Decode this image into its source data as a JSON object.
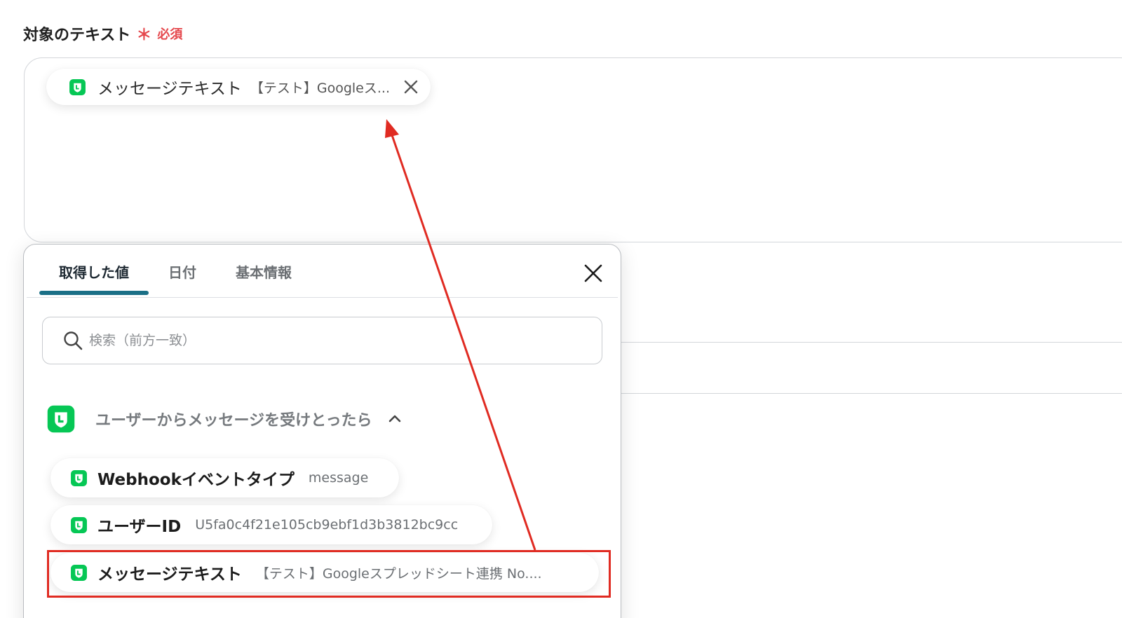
{
  "field": {
    "label": "対象のテキスト",
    "required_star": "＊",
    "required_text": "必須"
  },
  "input_chip": {
    "icon": "line-app-icon",
    "name": "メッセージテキスト",
    "value": "【テスト】Googleス...",
    "close_icon": "close-icon"
  },
  "panel": {
    "tabs": [
      {
        "label": "取得した値",
        "active": true
      },
      {
        "label": "日付",
        "active": false
      },
      {
        "label": "基本情報",
        "active": false
      }
    ],
    "close_icon": "close-icon",
    "search": {
      "icon": "search-icon",
      "placeholder": "検索（前方一致）",
      "value": ""
    },
    "group": {
      "icon": "line-app-icon",
      "title": "ユーザーからメッセージを受けとったら",
      "expanded_icon": "chevron-up-icon"
    },
    "items": [
      {
        "name": "Webhookイベントタイプ",
        "value": "message"
      },
      {
        "name": "ユーザーID",
        "value": "U5fa0c4f21e105cb9ebf1d3b3812bc9cc"
      },
      {
        "name": "メッセージテキスト",
        "value": "【テスト】Googleスプレッドシート連携 No...."
      }
    ]
  },
  "colors": {
    "accent_tab": "#1a6f86",
    "line_green": "#06c755",
    "required": "#e5484d",
    "annotation_red": "#e02b22"
  }
}
